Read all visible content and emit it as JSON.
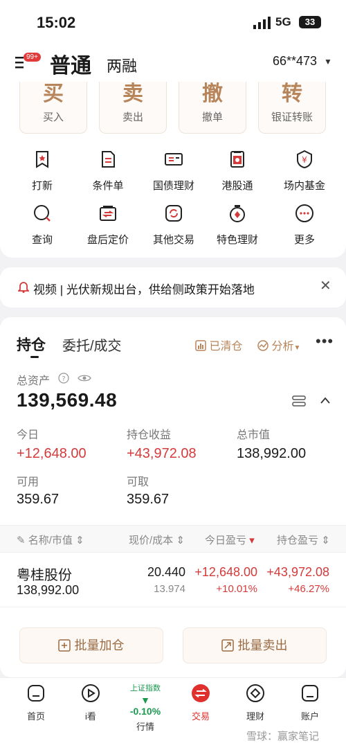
{
  "status": {
    "time": "15:02",
    "network": "5G",
    "battery": "33"
  },
  "header": {
    "badge": "99+",
    "account_type": "普通",
    "account_sub": "两融",
    "account_no": "66**473"
  },
  "actions": [
    {
      "char": "买",
      "label": "买入"
    },
    {
      "char": "卖",
      "label": "卖出"
    },
    {
      "char": "撤",
      "label": "撤单"
    },
    {
      "char": "转",
      "label": "银证转账"
    }
  ],
  "shortcuts": [
    {
      "label": "打新",
      "icon": "bookmark-icon"
    },
    {
      "label": "条件单",
      "icon": "document-icon"
    },
    {
      "label": "国债理财",
      "icon": "ticket-icon"
    },
    {
      "label": "港股通",
      "icon": "hk-flag-icon"
    },
    {
      "label": "场内基金",
      "icon": "yen-shield-icon"
    },
    {
      "label": "查询",
      "icon": "search-icon"
    },
    {
      "label": "盘后定价",
      "icon": "exchange-icon"
    },
    {
      "label": "其他交易",
      "icon": "refresh-icon"
    },
    {
      "label": "特色理财",
      "icon": "medal-icon"
    },
    {
      "label": "更多",
      "icon": "more-icon"
    }
  ],
  "notice": {
    "text": "视频 | 光伏新规出台，供给侧政策开始落地"
  },
  "holdings": {
    "tab_active": "持仓",
    "tab_other": "委托/成交",
    "cleared": "已清仓",
    "analysis": "分析",
    "total_assets_label": "总资产",
    "total_assets": "139,569.48",
    "today_label": "今日",
    "today_value": "+12,648.00",
    "pos_pnl_label": "持仓收益",
    "pos_pnl_value": "+43,972.08",
    "mkt_value_label": "总市值",
    "mkt_value": "138,992.00",
    "available_label": "可用",
    "available": "359.67",
    "withdrawable_label": "可取",
    "withdrawable": "359.67",
    "columns": [
      "名称/市值",
      "现价/成本",
      "今日盈亏",
      "持仓盈亏"
    ],
    "rows": [
      {
        "name": "粤桂股份",
        "mkt": "138,992.00",
        "price": "20.440",
        "cost": "13.974",
        "today_pnl": "+12,648.00",
        "today_pct": "+10.01%",
        "pos_pnl": "+43,972.08",
        "pos_pct": "+46.27%"
      }
    ],
    "batch_add": "批量加仓",
    "batch_sell": "批量卖出"
  },
  "tabbar": {
    "home": "首页",
    "iwatch": "i看",
    "index_name": "上证指数",
    "index_change": "▼ -0.10%",
    "market": "行情",
    "trade": "交易",
    "finance": "理财",
    "account": "账户"
  },
  "watermark": "雪球：赢家笔记",
  "colors": {
    "accent_gold": "#b8845a",
    "rise_red": "#d43a3a",
    "fall_green": "#1a9a50"
  }
}
